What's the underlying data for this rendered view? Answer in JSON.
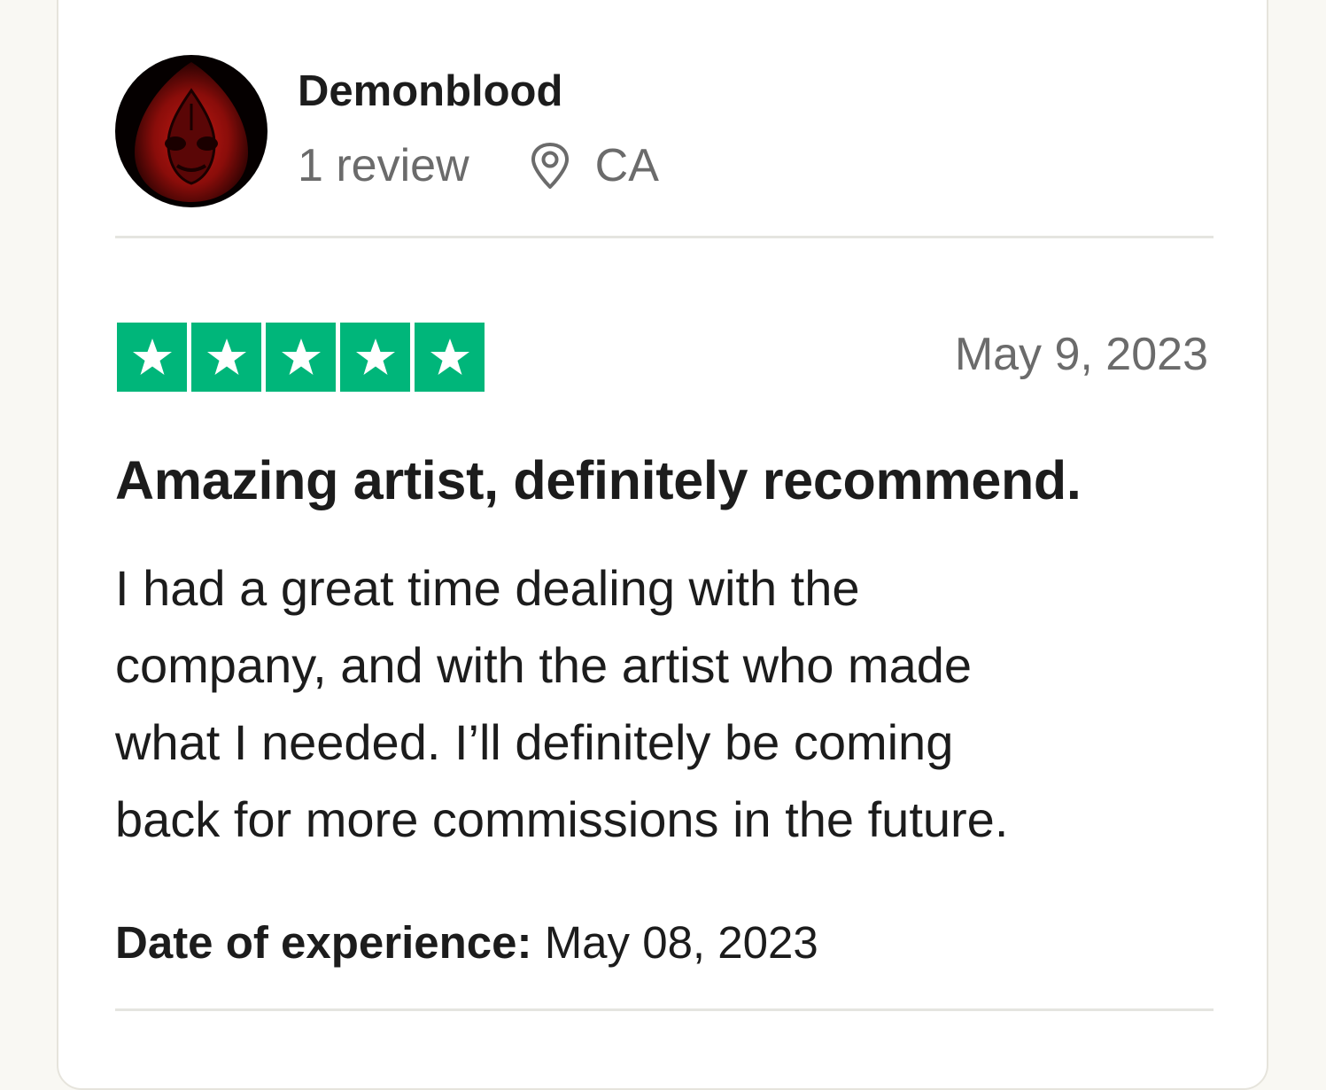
{
  "reviewer": {
    "name": "Demonblood",
    "review_count": "1 review",
    "location": "CA",
    "avatar_icon": "demon-mask-avatar",
    "location_icon": "map-pin-icon"
  },
  "review": {
    "rating": 5,
    "rating_max": 5,
    "star_color": "#00b67a",
    "date": "May 9, 2023",
    "title": "Amazing artist, definitely recommend.",
    "body_lines": [
      "I had a great time dealing with the",
      "company, and with the artist who made",
      "what I needed. I’ll definitely be coming",
      "back for more commissions in the future."
    ],
    "experience_label": "Date of experience:",
    "experience_date": "May 08, 2023"
  }
}
